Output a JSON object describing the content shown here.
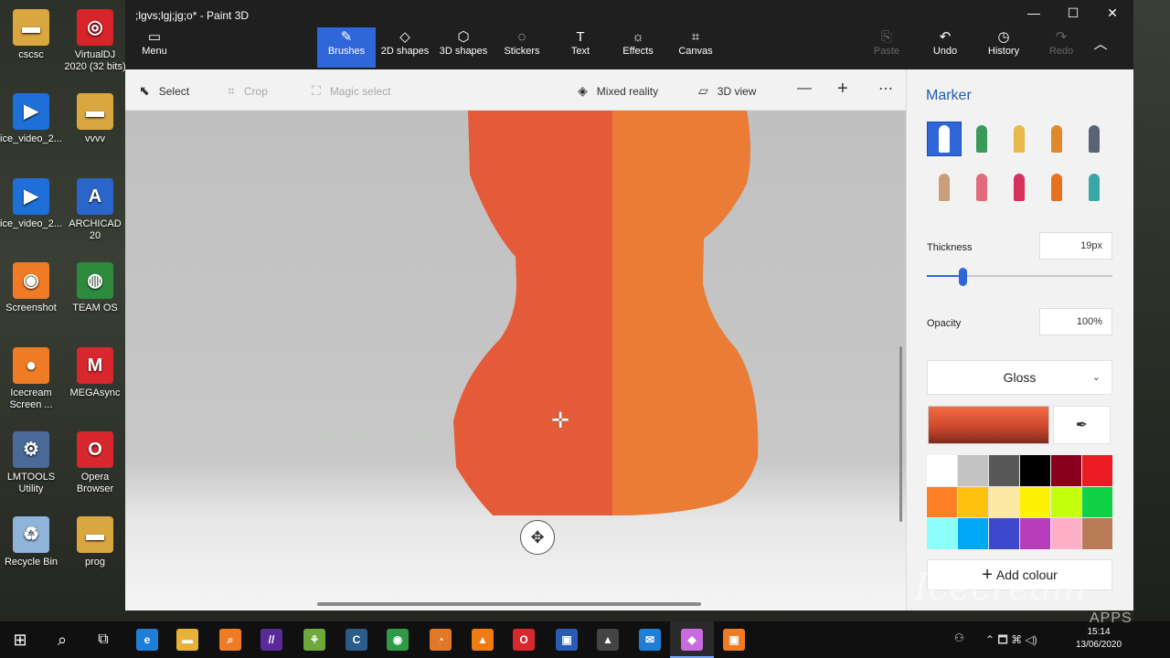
{
  "desktop": {
    "icons": [
      {
        "label": "cscsc",
        "color": "#d9a640",
        "glyph": "▬"
      },
      {
        "label": "VirtualDJ 2020 (32 bits)",
        "color": "#d8232a",
        "glyph": "◎"
      },
      {
        "label": "ice_video_2...",
        "color": "#1e6fd8",
        "glyph": "▶"
      },
      {
        "label": "vvvv",
        "color": "#d9a640",
        "glyph": "▬"
      },
      {
        "label": "ice_video_2...",
        "color": "#1e6fd8",
        "glyph": "▶"
      },
      {
        "label": "ARCHICAD 20",
        "color": "#2a65c9",
        "glyph": "A"
      },
      {
        "label": "Screenshot",
        "color": "#f07b25",
        "glyph": "◉"
      },
      {
        "label": "TEAM OS",
        "color": "#2e8b3e",
        "glyph": "◍"
      },
      {
        "label": "Icecream Screen ...",
        "color": "#f07b25",
        "glyph": "●"
      },
      {
        "label": "MEGAsync",
        "color": "#d9272e",
        "glyph": "M"
      },
      {
        "label": "LMTOOLS Utility",
        "color": "#4a6a9a",
        "glyph": "⚙"
      },
      {
        "label": "Opera Browser",
        "color": "#d9272e",
        "glyph": "O"
      },
      {
        "label": "Recycle Bin",
        "color": "#8fb3d9",
        "glyph": "♻"
      },
      {
        "label": "prog",
        "color": "#d9a640",
        "glyph": "▬"
      }
    ]
  },
  "window": {
    "title": ";lgvs;lgj;jg;o* - Paint 3D",
    "minimize_icon": "—",
    "maximize_icon": "☐",
    "close_icon": "✕"
  },
  "ribbon": {
    "menu": {
      "label": "Menu",
      "icon": "▭"
    },
    "tabs": [
      {
        "label": "Brushes",
        "icon": "✎"
      },
      {
        "label": "2D shapes",
        "icon": "◇"
      },
      {
        "label": "3D shapes",
        "icon": "⬡"
      },
      {
        "label": "Stickers",
        "icon": "◌"
      },
      {
        "label": "Text",
        "icon": "T"
      },
      {
        "label": "Effects",
        "icon": "☼"
      },
      {
        "label": "Canvas",
        "icon": "⌗"
      }
    ],
    "paste": {
      "label": "Paste",
      "icon": "⎘"
    },
    "undo": {
      "label": "Undo",
      "icon": "↶"
    },
    "history": {
      "label": "History",
      "icon": "◷"
    },
    "redo": {
      "label": "Redo",
      "icon": "↷"
    },
    "collapse_icon": "︿"
  },
  "toolbar": {
    "select": {
      "label": "Select",
      "icon": "⬉"
    },
    "crop": {
      "label": "Crop",
      "icon": "⌗"
    },
    "magic_select": {
      "label": "Magic select",
      "icon": "⛶"
    },
    "mixed_reality": {
      "label": "Mixed reality",
      "icon": "◈"
    },
    "view_3d": {
      "label": "3D view",
      "icon": "▱"
    },
    "zoom_out": "—",
    "zoom_in": "+",
    "more": "⋯"
  },
  "canvas": {
    "rotate_icon": "✥",
    "cursor_icon": "✛",
    "shape_left_color": "#e55b3a",
    "shape_right_color": "#ea7c36"
  },
  "panel": {
    "title": "Marker",
    "brushes": [
      {
        "name": "marker",
        "color": "#2f66d9"
      },
      {
        "name": "calligraphy-pen",
        "color": "#3a9a5a"
      },
      {
        "name": "oil-brush",
        "color": "#e8b84a"
      },
      {
        "name": "watercolor",
        "color": "#e0892a"
      },
      {
        "name": "pixel-pen",
        "color": "#5a6475"
      },
      {
        "name": "pencil",
        "color": "#c7a07a"
      },
      {
        "name": "eraser",
        "color": "#e26a7a"
      },
      {
        "name": "crayon",
        "color": "#d6315a"
      },
      {
        "name": "spray-can",
        "color": "#e8711f"
      },
      {
        "name": "fill",
        "color": "#3ba6a6"
      }
    ],
    "thickness_label": "Thickness",
    "thickness_value": "19px",
    "thickness_level": 0.19,
    "opacity_label": "Opacity",
    "opacity_value": "100%",
    "finish": "Gloss",
    "finish_chevron": "⌄",
    "eyedropper_icon": "✒",
    "current_color": "#e55b3a",
    "palette": [
      "#ffffff",
      "#c3c3c3",
      "#585858",
      "#000000",
      "#88001b",
      "#ec1c24",
      "#ff7f27",
      "#ffc20e",
      "#fde9a4",
      "#fff200",
      "#c4ff0e",
      "#0ed145",
      "#8cfffb",
      "#00a8f3",
      "#3f48cc",
      "#b83dba",
      "#ffaec8",
      "#b97a56"
    ],
    "add_colour": "Add colour",
    "add_icon": "+"
  },
  "taskbar": {
    "start_icon": "⊞",
    "search_icon": "⌕",
    "taskview_icon": "⧉",
    "apps": [
      {
        "name": "edge",
        "color": "#1f7fd6",
        "glyph": "e"
      },
      {
        "name": "file-explorer",
        "color": "#e8b23a",
        "glyph": "▬"
      },
      {
        "name": "search-app",
        "color": "#f07b25",
        "glyph": "⌕"
      },
      {
        "name": "purple-app",
        "color": "#5b2a9a",
        "glyph": "//"
      },
      {
        "name": "green-app",
        "color": "#6fa83a",
        "glyph": "⚘"
      },
      {
        "name": "cad-app",
        "color": "#2b5d8a",
        "glyph": "C"
      },
      {
        "name": "chrome",
        "color": "#2f9a4a",
        "glyph": "◉"
      },
      {
        "name": "orange-app",
        "color": "#e0782a",
        "glyph": "◔"
      },
      {
        "name": "vlc",
        "color": "#f07b12",
        "glyph": "▲"
      },
      {
        "name": "opera",
        "color": "#d9272e",
        "glyph": "O"
      },
      {
        "name": "blue-app",
        "color": "#2a5bb5",
        "glyph": "▣"
      },
      {
        "name": "photos",
        "color": "#444444",
        "glyph": "▲"
      },
      {
        "name": "mail",
        "color": "#1f7fd6",
        "glyph": "✉"
      },
      {
        "name": "paint-3d",
        "color": "#c86be0",
        "glyph": "◆"
      },
      {
        "name": "icecream",
        "color": "#f07b25",
        "glyph": "▣"
      }
    ],
    "tray_people": "⚇",
    "tray_icons": "⌃ 🗖 ⌘ ◁)",
    "time": "15:14",
    "date": "13/06/2020"
  },
  "watermark": {
    "brand": "Icecream",
    "sub": "APPS"
  }
}
